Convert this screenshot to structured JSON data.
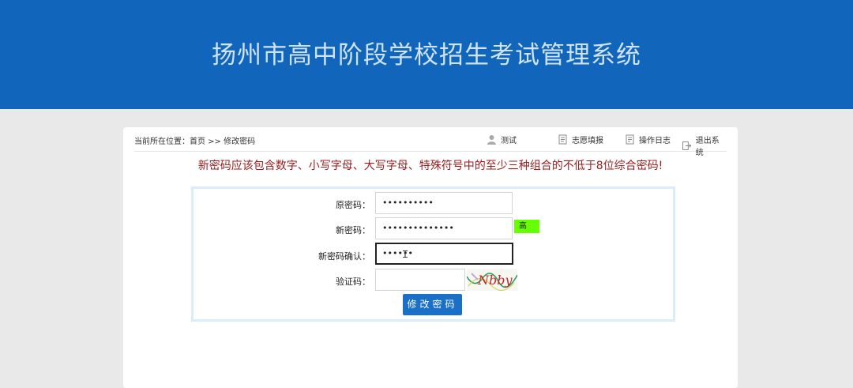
{
  "header": {
    "title": "扬州市高中阶段学校招生考试管理系统"
  },
  "breadcrumb": {
    "prefix": "当前所在位置：",
    "home": "首页",
    "separator": " >> ",
    "current": "修改密码"
  },
  "topnav": {
    "user": "测试",
    "apply": "志愿填报",
    "log": "操作日志",
    "logout": "退出系统"
  },
  "notice": "新密码应该包含数字、小写字母、大写字母、特殊符号中的至少三种组合的不低于8位综合密码!",
  "form": {
    "old_password": {
      "label": "原密码：",
      "value": "••••••••••"
    },
    "new_password": {
      "label": "新密码：",
      "value": "••••••••••••••",
      "strength": "高"
    },
    "confirm_password": {
      "label": "新密码确认：",
      "value": "••••••"
    },
    "captcha": {
      "label": "验证码：",
      "value": "",
      "image_text": "Nbby"
    },
    "submit_label": "修改密码"
  },
  "colors": {
    "header": "#1166bb",
    "notice": "#9b1c1c",
    "strength": "#66ff00",
    "button": "#1a6fc7"
  }
}
